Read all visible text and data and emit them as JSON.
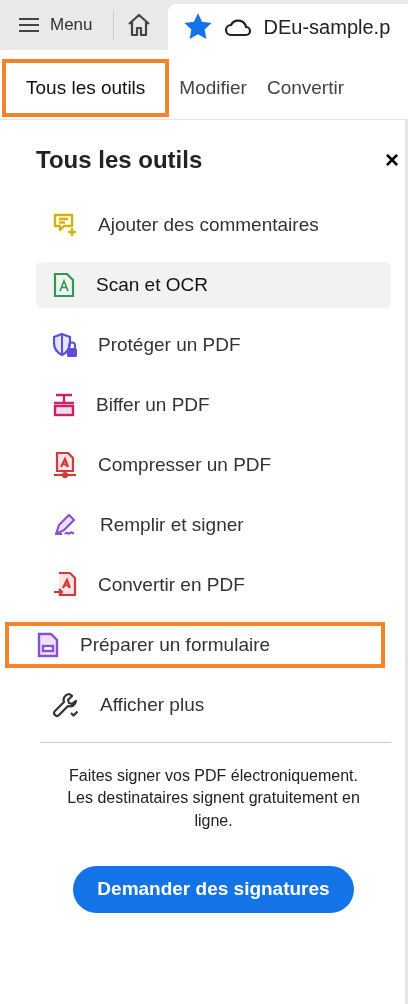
{
  "top_bar": {
    "menu_label": "Menu",
    "document_tab": {
      "title": "DEu-sample.p",
      "starred": true
    }
  },
  "tabs": [
    {
      "label": "Tous les outils",
      "selected": true,
      "highlighted": true
    },
    {
      "label": "Modifier",
      "selected": false,
      "highlighted": false
    },
    {
      "label": "Convertir",
      "selected": false,
      "highlighted": false
    }
  ],
  "panel": {
    "title": "Tous les outils",
    "close": "×",
    "tools": [
      {
        "label": "Ajouter des commentaires",
        "kind": "comment",
        "selected": false,
        "highlighted": false
      },
      {
        "label": "Scan et OCR",
        "kind": "scan",
        "selected": true,
        "highlighted": false
      },
      {
        "label": "Protéger un PDF",
        "kind": "protect",
        "selected": false,
        "highlighted": false
      },
      {
        "label": "Biffer un PDF",
        "kind": "redact",
        "selected": false,
        "highlighted": false
      },
      {
        "label": "Compresser un PDF",
        "kind": "compress",
        "selected": false,
        "highlighted": false
      },
      {
        "label": "Remplir et signer",
        "kind": "sign",
        "selected": false,
        "highlighted": false
      },
      {
        "label": "Convertir en PDF",
        "kind": "convert",
        "selected": false,
        "highlighted": false
      },
      {
        "label": "Préparer un formulaire",
        "kind": "form",
        "selected": false,
        "highlighted": true
      },
      {
        "label": "Afficher plus",
        "kind": "more",
        "selected": false,
        "highlighted": false
      }
    ],
    "promo": {
      "lines": [
        "Faites signer vos PDF électroniquement.",
        "Les destinataires signent gratuitement en ligne."
      ],
      "button": "Demander des signatures"
    }
  }
}
